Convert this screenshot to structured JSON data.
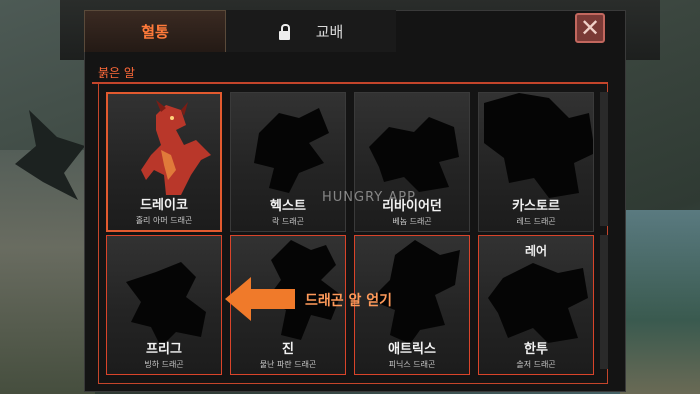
{
  "tabs": [
    {
      "label": "혈통",
      "active": true
    },
    {
      "label": "교배",
      "locked": true,
      "active": false
    }
  ],
  "section_label": "붉은 알",
  "cards": [
    {
      "name": "드레이코",
      "sub": "홀리 아머 드래곤",
      "revealed": true,
      "selected": true
    },
    {
      "name": "헥스트",
      "sub": "락 드래곤",
      "revealed": false
    },
    {
      "name": "리바이어던",
      "sub": "베놈 드래곤",
      "revealed": false
    },
    {
      "name": "카스토르",
      "sub": "레드 드래곤",
      "revealed": false
    },
    {
      "name": "프리그",
      "sub": "빙하 드래곤",
      "revealed": false
    },
    {
      "name": "진",
      "sub": "물난 파란 드래곤",
      "revealed": false
    },
    {
      "name": "애트릭스",
      "sub": "피닉스 드래곤",
      "revealed": false
    },
    {
      "name": "한투",
      "sub": "솔저 드래곤",
      "revealed": false,
      "badge": "레어"
    }
  ],
  "hint": "드래곤 알 얻기",
  "watermark": "HUNGRY APP",
  "colors": {
    "accent": "#e35a2f",
    "tab_active": "#ff7a3a",
    "close_bg": "#7a3a36"
  },
  "icons": {
    "lock": "lock-icon",
    "close": "close-icon",
    "arrow": "arrow-left-icon"
  }
}
